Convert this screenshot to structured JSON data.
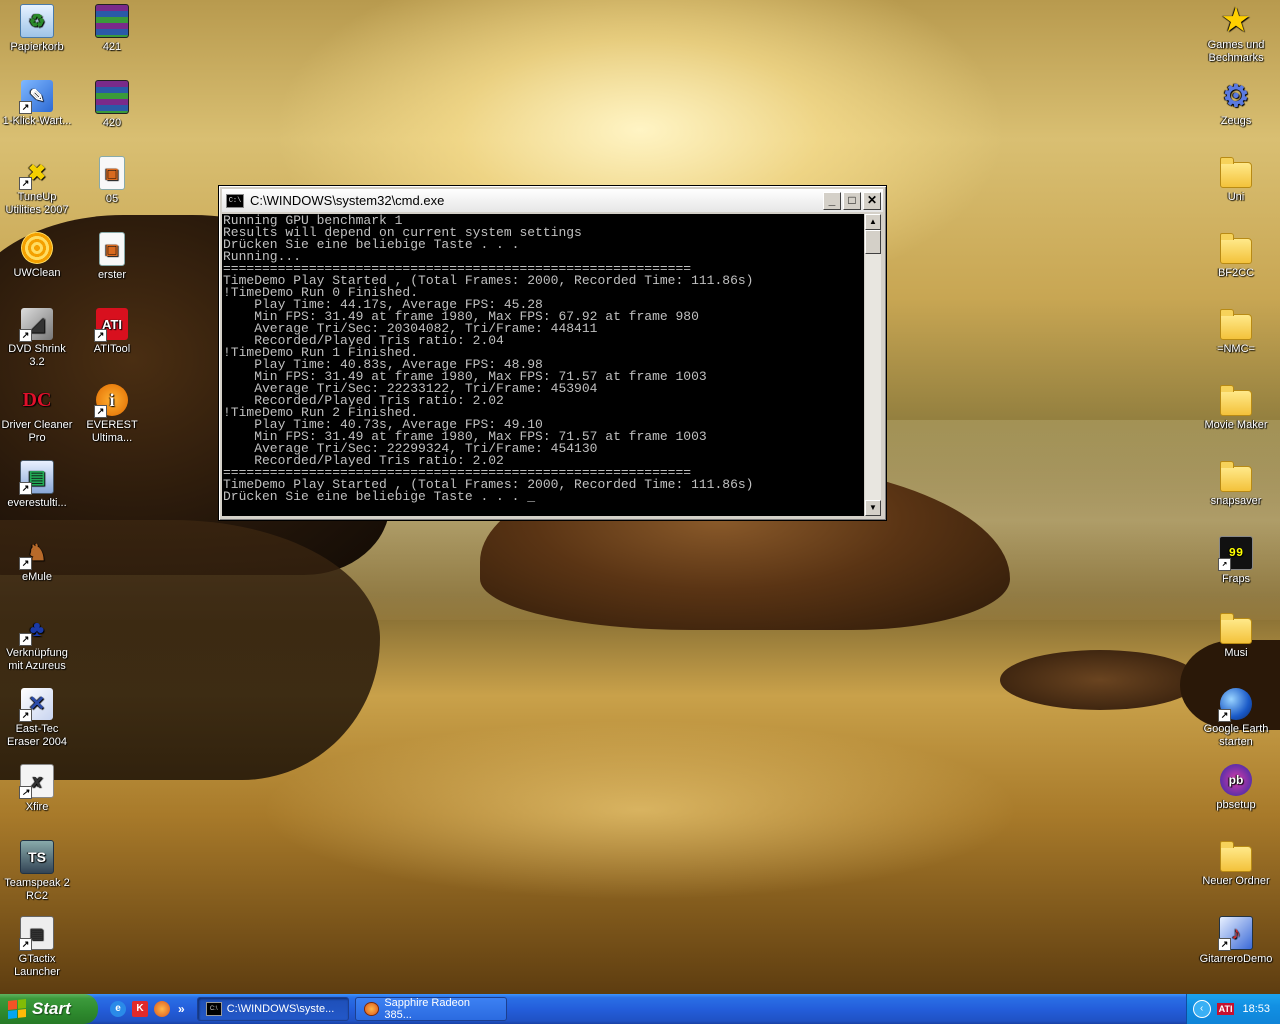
{
  "desktop": {
    "icons_left": [
      {
        "label": "Papierkorb",
        "icon": "recycle-bin-icon"
      },
      {
        "label": "1-Klick-Wart...",
        "icon": "maintenance-icon"
      },
      {
        "label": "TuneUp Utilities 2007",
        "icon": "tuneup-icon"
      },
      {
        "label": "UWClean",
        "icon": "uwclean-icon"
      },
      {
        "label": "DVD Shrink 3.2",
        "icon": "dvd-shrink-icon"
      },
      {
        "label": "Driver Cleaner Pro",
        "icon": "driver-cleaner-icon"
      },
      {
        "label": "everestulti...",
        "icon": "everest-file-icon"
      },
      {
        "label": "eMule",
        "icon": "emule-icon"
      },
      {
        "label": "Verknüpfung mit Azureus",
        "icon": "azureus-icon"
      },
      {
        "label": "East-Tec Eraser 2004",
        "icon": "eraser-icon"
      },
      {
        "label": "Xfire",
        "icon": "xfire-icon"
      },
      {
        "label": "Teamspeak 2 RC2",
        "icon": "teamspeak-icon"
      },
      {
        "label": "GTactix Launcher",
        "icon": "gtactix-icon"
      }
    ],
    "icons_left2": [
      {
        "label": "421",
        "icon": "rar-archive-icon"
      },
      {
        "label": "420",
        "icon": "rar-archive-icon"
      },
      {
        "label": "05",
        "icon": "document-icon"
      },
      {
        "label": "erster",
        "icon": "document-icon"
      },
      {
        "label": "ATITool",
        "icon": "atitool-icon"
      },
      {
        "label": "EVEREST Ultima...",
        "icon": "everest-icon"
      }
    ],
    "icons_right": [
      {
        "label": "Games und Bechmarks",
        "icon": "star-icon"
      },
      {
        "label": "Zeugs",
        "icon": "gear-icon"
      },
      {
        "label": "Uni",
        "icon": "folder-icon"
      },
      {
        "label": "BF2CC",
        "icon": "folder-icon"
      },
      {
        "label": "=NMC=",
        "icon": "folder-icon"
      },
      {
        "label": "Movie Maker",
        "icon": "folder-icon"
      },
      {
        "label": "snapsaver",
        "icon": "folder-icon"
      },
      {
        "label": "Fraps",
        "icon": "fraps-icon"
      },
      {
        "label": "Musi",
        "icon": "folder-icon"
      },
      {
        "label": "Google Earth starten",
        "icon": "google-earth-icon"
      },
      {
        "label": "pbsetup",
        "icon": "pbsetup-icon"
      },
      {
        "label": "Neuer Ordner",
        "icon": "folder-icon"
      },
      {
        "label": "GitarreroDemo",
        "icon": "gitarrero-icon"
      }
    ]
  },
  "cmd": {
    "title": "C:\\WINDOWS\\system32\\cmd.exe",
    "lines": [
      "Running GPU benchmark 1",
      "Results will depend on current system settings",
      "Drücken Sie eine beliebige Taste . . .",
      "Running...",
      "============================================================",
      "TimeDemo Play Started , (Total Frames: 2000, Recorded Time: 111.86s)",
      "!TimeDemo Run 0 Finished.",
      "    Play Time: 44.17s, Average FPS: 45.28",
      "    Min FPS: 31.49 at frame 1980, Max FPS: 67.92 at frame 980",
      "    Average Tri/Sec: 20304082, Tri/Frame: 448411",
      "    Recorded/Played Tris ratio: 2.04",
      "!TimeDemo Run 1 Finished.",
      "    Play Time: 40.83s, Average FPS: 48.98",
      "    Min FPS: 31.49 at frame 1980, Max FPS: 71.57 at frame 1003",
      "    Average Tri/Sec: 22233122, Tri/Frame: 453904",
      "    Recorded/Played Tris ratio: 2.02",
      "!TimeDemo Run 2 Finished.",
      "    Play Time: 40.73s, Average FPS: 49.10",
      "    Min FPS: 31.49 at frame 1980, Max FPS: 71.57 at frame 1003",
      "    Average Tri/Sec: 22299324, Tri/Frame: 454130",
      "    Recorded/Played Tris ratio: 2.02",
      "============================================================",
      "TimeDemo Play Started , (Total Frames: 2000, Recorded Time: 111.86s)",
      "Drücken Sie eine beliebige Taste . . . _"
    ]
  },
  "taskbar": {
    "start_label": "Start",
    "more_label": "»",
    "tasks": [
      {
        "label": "C:\\WINDOWS\\syste...",
        "icon": "cmd-icon"
      },
      {
        "label": "Sapphire Radeon 385...",
        "icon": "firefox-icon"
      }
    ],
    "tray_chevron": "‹",
    "tray_ati": "ATI",
    "clock": "18:53"
  }
}
